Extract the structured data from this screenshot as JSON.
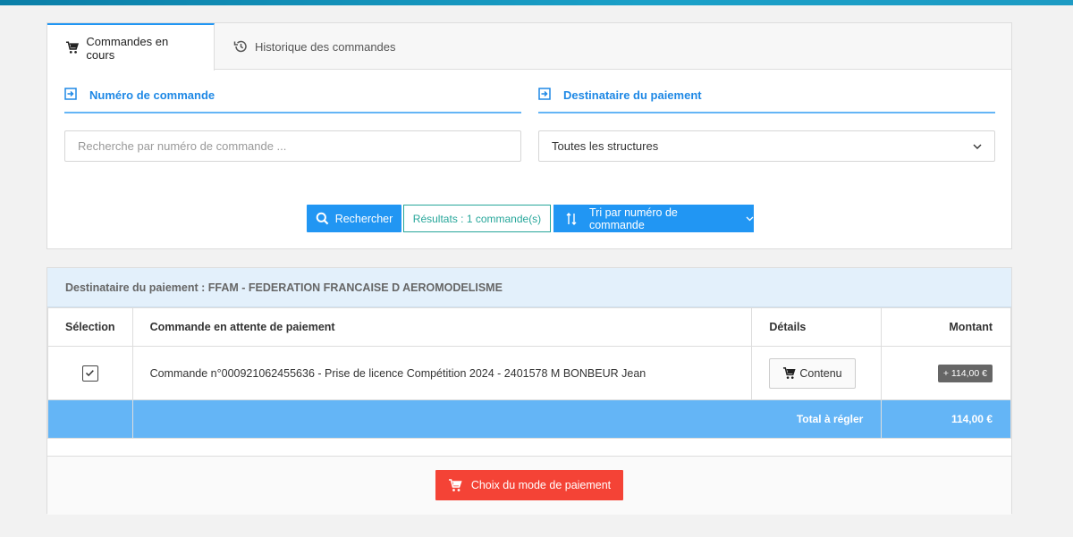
{
  "tabs": [
    {
      "label": "Commandes en cours",
      "icon": "cart-icon",
      "active": true
    },
    {
      "label": "Historique des commandes",
      "icon": "history-icon",
      "active": false
    }
  ],
  "filters": {
    "order_number": {
      "title": "Numéro de commande",
      "placeholder": "Recherche par numéro de commande ..."
    },
    "recipient": {
      "title": "Destinataire du paiement",
      "selected": "Toutes les structures"
    }
  },
  "actions": {
    "search_label": "Rechercher",
    "results_label": "Résultats : 1 commande(s)",
    "sort_label": "Tri par numéro de commande"
  },
  "orders": {
    "recipient_header": "Destinataire du paiement : FFAM - FEDERATION FRANCAISE D AEROMODELISME",
    "columns": [
      "Sélection",
      "Commande en attente de paiement",
      "Détails",
      "Montant"
    ],
    "rows": [
      {
        "selected": true,
        "description": "Commande n°000921062455636 - Prise de licence Compétition 2024 - 2401578 M BONBEUR Jean",
        "details_label": "Contenu",
        "amount": "+ 114,00 €"
      }
    ],
    "total_label": "Total à régler",
    "total_value": "114,00 €",
    "pay_label": "Choix du mode de paiement"
  },
  "colors": {
    "primary": "#2196f3",
    "teal": "#26a69a",
    "danger": "#f44336",
    "total_bg": "#64b5f6"
  }
}
